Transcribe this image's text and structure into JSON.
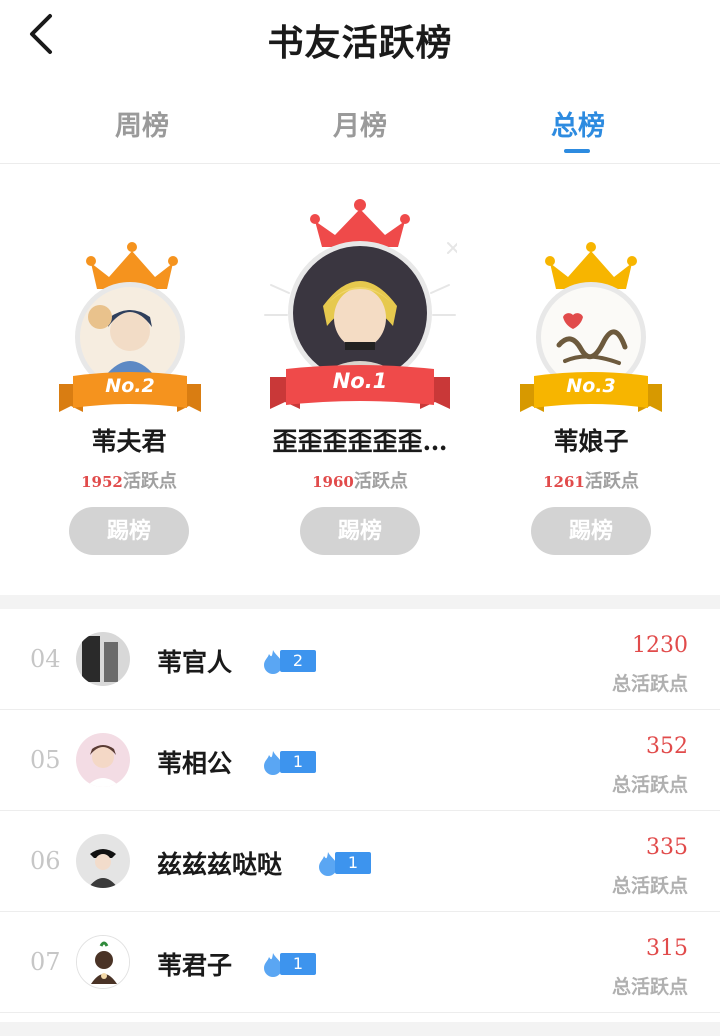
{
  "header": {
    "title": "书友活跃榜"
  },
  "tabs": [
    {
      "label": "周榜"
    },
    {
      "label": "月榜"
    },
    {
      "label": "总榜"
    }
  ],
  "podium": {
    "second": {
      "rank_label": "No.2",
      "name": "苇夫君",
      "points": "1952",
      "points_suffix": "活跃点",
      "kick_label": "踢榜"
    },
    "first": {
      "rank_label": "No.1",
      "name": "歪歪歪歪歪歪…",
      "points": "1960",
      "points_suffix": "活跃点",
      "kick_label": "踢榜"
    },
    "third": {
      "rank_label": "No.3",
      "name": "苇娘子",
      "points": "1261",
      "points_suffix": "活跃点",
      "kick_label": "踢榜"
    }
  },
  "list": [
    {
      "rank": "04",
      "name": "苇官人",
      "level": "2",
      "score": "1230",
      "score_label": "总活跃点"
    },
    {
      "rank": "05",
      "name": "苇相公",
      "level": "1",
      "score": "352",
      "score_label": "总活跃点"
    },
    {
      "rank": "06",
      "name": "兹兹兹哒哒",
      "level": "1",
      "score": "335",
      "score_label": "总活跃点"
    },
    {
      "rank": "07",
      "name": "苇君子",
      "level": "1",
      "score": "315",
      "score_label": "总活跃点"
    }
  ],
  "colors": {
    "accent_blue": "#2d8be0",
    "gold_orange": "#f5931e",
    "red_first": "#ef4a4a",
    "yellow_third": "#f7b500",
    "score_red": "#e14b4b"
  },
  "icons": [
    "back-arrow-icon",
    "crown-icon",
    "fire-icon"
  ]
}
